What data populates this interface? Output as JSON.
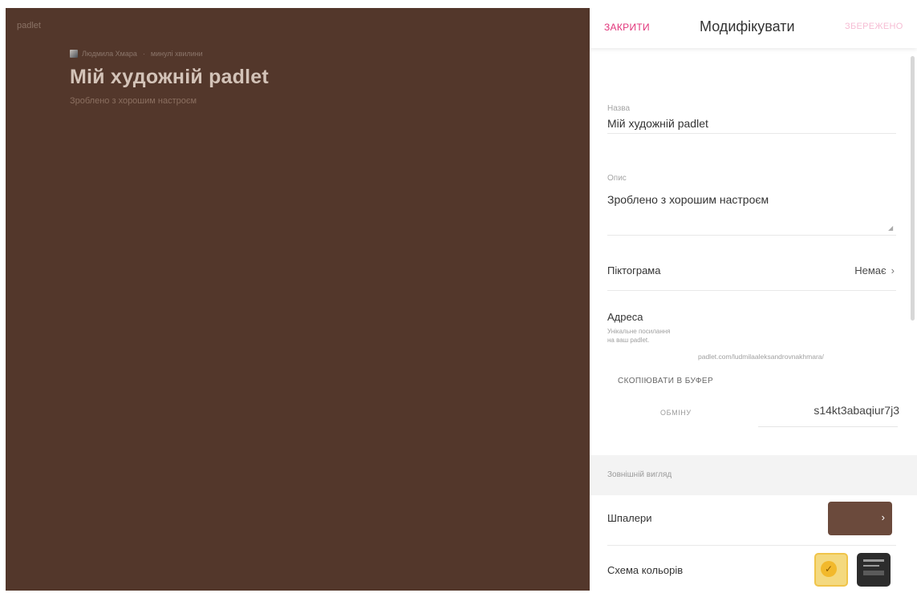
{
  "board": {
    "brand": "padlet",
    "author": "Людмила Хмара",
    "breadcrumb_extra": "минулі хвилини",
    "title": "Мій художній padlet",
    "subtitle": "Зроблено з хорошим настроєм",
    "wallpaper_color": "#53372b"
  },
  "panel": {
    "close_label": "ЗАКРИТИ",
    "heading": "Модифікувати",
    "save_label": "ЗБЕРЕЖЕНО",
    "accent_color": "#e1347a",
    "title_field": {
      "label": "Назва",
      "value": "Мій художній padlet"
    },
    "description_field": {
      "label": "Опис",
      "value": "Зроблено з хорошим настроєм"
    },
    "icon_row": {
      "label": "Піктограма",
      "value": "Немає"
    },
    "address": {
      "label": "Адреса",
      "description": "Унікальне посилання на ваш padlet.",
      "url": "padlet.com/ludmilaaleksandrovnakhmara/",
      "copy_label": "СКОПІЮВАТИ В БУФЕР",
      "change_label": "ОБМІНУ",
      "slug": "s14kt3abaqiur7j3"
    },
    "appearance_section": "Зовнішній вигляд",
    "wallpaper_row": {
      "label": "Шпалери",
      "thumb_color": "#6b4a3c"
    },
    "color_scheme_row": {
      "label": "Схема кольорів",
      "options": [
        "light-scheme-icon",
        "dark-scheme-icon"
      ],
      "selected": "light-scheme-icon"
    }
  }
}
